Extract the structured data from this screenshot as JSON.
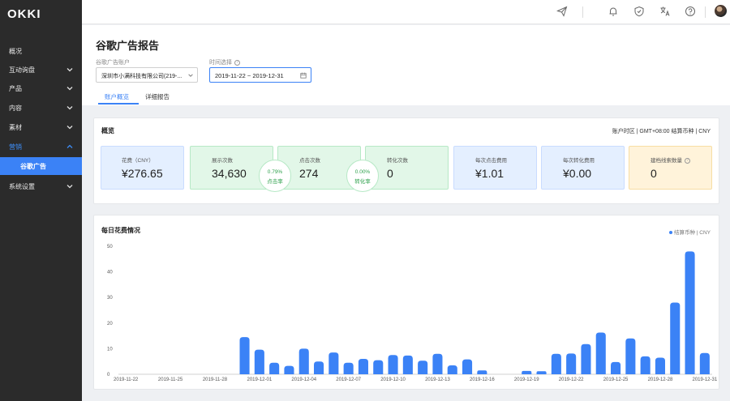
{
  "app": {
    "logo": "OKKI"
  },
  "sidebar": {
    "items": [
      {
        "label": "概况",
        "has_chevron": false
      },
      {
        "label": "互动询盘",
        "has_chevron": true
      },
      {
        "label": "产品",
        "has_chevron": true
      },
      {
        "label": "内容",
        "has_chevron": true
      },
      {
        "label": "素材",
        "has_chevron": true
      },
      {
        "label": "营销",
        "has_chevron": true,
        "expanded": true
      },
      {
        "label": "谷歌广告",
        "sub": true,
        "active": true
      },
      {
        "label": "系统设置",
        "has_chevron": true
      }
    ]
  },
  "topbar": {
    "icons": [
      "send-icon",
      "bell-icon",
      "shield-icon",
      "translate-icon",
      "help-icon"
    ]
  },
  "header": {
    "title": "谷歌广告报告",
    "account_label": "谷歌广告账户",
    "account_value": "深圳市小满科技有限公司(219-...",
    "time_label": "时间选择",
    "time_value": "2019-11-22 ~ 2019-12-31",
    "tabs": [
      {
        "label": "账户概览",
        "active": true
      },
      {
        "label": "详细报告",
        "active": false
      }
    ]
  },
  "overview": {
    "title": "概览",
    "meta": "账户时区 | GMT+08:00   结算币种 | CNY",
    "metrics": [
      {
        "label": "花费（CNY）",
        "value": "¥276.65"
      },
      {
        "label": "展示次数",
        "value": "34,630"
      },
      {
        "label": "点击次数",
        "value": "274"
      },
      {
        "label": "转化次数",
        "value": "0"
      },
      {
        "label": "每次点击费用",
        "value": "¥1.01"
      },
      {
        "label": "每次转化费用",
        "value": "¥0.00"
      },
      {
        "label": "建档线索数量",
        "value": "0"
      }
    ],
    "rates": [
      {
        "value": "0.79%",
        "label": "点击率"
      },
      {
        "value": "0.00%",
        "label": "转化率"
      }
    ],
    "colors": {
      "blue": "#e4efff",
      "green": "#e2f7e8",
      "yellow": "#fff3da"
    }
  },
  "chart_card": {
    "title": "每日花费情况",
    "legend": "结算币种 | CNY"
  },
  "chart_data": {
    "type": "bar",
    "title": "每日花费情况",
    "ylim": [
      0,
      50
    ],
    "yticks": [
      0,
      10,
      20,
      30,
      40,
      50
    ],
    "xtick_labels": [
      "2019-11-22",
      "2019-11-25",
      "2019-11-28",
      "2019-12-01",
      "2019-12-04",
      "2019-12-07",
      "2019-12-10",
      "2019-12-13",
      "2019-12-16",
      "2019-12-19",
      "2019-12-22",
      "2019-12-25",
      "2019-12-28",
      "2019-12-31"
    ],
    "categories": [
      "2019-11-22",
      "2019-11-23",
      "2019-11-24",
      "2019-11-25",
      "2019-11-26",
      "2019-11-27",
      "2019-11-28",
      "2019-11-29",
      "2019-11-30",
      "2019-12-01",
      "2019-12-02",
      "2019-12-03",
      "2019-12-04",
      "2019-12-05",
      "2019-12-06",
      "2019-12-07",
      "2019-12-08",
      "2019-12-09",
      "2019-12-10",
      "2019-12-11",
      "2019-12-12",
      "2019-12-13",
      "2019-12-14",
      "2019-12-15",
      "2019-12-16",
      "2019-12-17",
      "2019-12-18",
      "2019-12-19",
      "2019-12-20",
      "2019-12-21",
      "2019-12-22",
      "2019-12-23",
      "2019-12-24",
      "2019-12-25",
      "2019-12-26",
      "2019-12-27",
      "2019-12-28",
      "2019-12-29",
      "2019-12-30",
      "2019-12-31"
    ],
    "values": [
      0,
      0,
      0,
      0,
      0,
      0,
      0,
      0,
      14.5,
      9.6,
      4.5,
      3.3,
      10.0,
      5.0,
      8.5,
      4.5,
      6.0,
      5.5,
      7.5,
      7.3,
      5.3,
      8.0,
      3.5,
      5.8,
      1.5,
      0,
      0,
      1.3,
      1.2,
      8.0,
      8.1,
      11.8,
      16.3,
      4.8,
      14.0,
      7.0,
      6.5,
      28.0,
      48.0,
      8.3
    ],
    "color": "#3b82f6",
    "grid": false
  }
}
